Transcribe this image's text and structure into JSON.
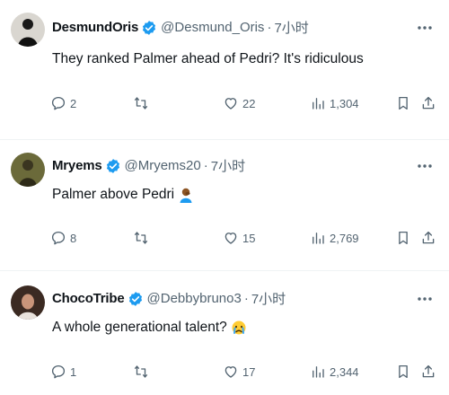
{
  "tweets": [
    {
      "name": "DesmundOris",
      "handle": "@Desmund_Oris",
      "separator": "·",
      "time": "7小时",
      "text": "They ranked Palmer ahead of Pedri? It's ridiculous",
      "replies": "2",
      "retweets": "",
      "likes": "22",
      "views": "1,304",
      "avatar_icon": "avatar-dark-photo"
    },
    {
      "name": "Mryems",
      "handle": "@Mryems20",
      "separator": "·",
      "time": "7小时",
      "text": "Palmer above Pedri",
      "emoji": "person-facepalming-emoji",
      "replies": "8",
      "retweets": "",
      "likes": "15",
      "views": "2,769",
      "avatar_icon": "avatar-olive-photo"
    },
    {
      "name": "ChocoTribe",
      "handle": "@Debbybruno3",
      "separator": "·",
      "time": "7小时",
      "text": "A whole generational talent?",
      "emoji": "crying-face-emoji",
      "replies": "1",
      "retweets": "",
      "likes": "17",
      "views": "2,344",
      "avatar_icon": "avatar-woman-photo"
    }
  ],
  "colors": {
    "verified_blue": "#1d9bf0",
    "secondary_text": "#536471",
    "divider": "#eff3f4"
  }
}
